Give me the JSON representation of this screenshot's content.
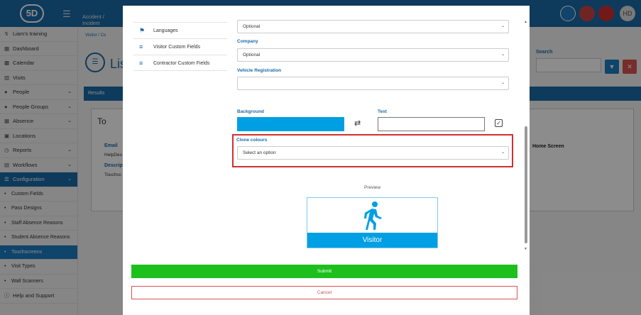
{
  "app": {
    "logo_text": "5D",
    "topbar_item": "Accident / Incident",
    "avatar_initials": "HD"
  },
  "sidebar": {
    "items": [
      {
        "label": "Liam's training",
        "icon": "training-icon"
      },
      {
        "label": "Dashboard",
        "icon": "dashboard-icon"
      },
      {
        "label": "Calendar",
        "icon": "calendar-icon"
      },
      {
        "label": "Visits",
        "icon": "visits-icon"
      },
      {
        "label": "People",
        "icon": "people-icon"
      },
      {
        "label": "People Groups",
        "icon": "people-groups-icon"
      },
      {
        "label": "Absence",
        "icon": "absence-icon"
      },
      {
        "label": "Locations",
        "icon": "locations-icon"
      },
      {
        "label": "Reports",
        "icon": "reports-icon"
      },
      {
        "label": "Workflows",
        "icon": "workflows-icon"
      },
      {
        "label": "Configuration",
        "icon": "configuration-icon"
      },
      {
        "label": "Custom Fields"
      },
      {
        "label": "Pass Designs"
      },
      {
        "label": "Staff Absence Reasons"
      },
      {
        "label": "Student Absence Reasons"
      },
      {
        "label": "Touchscreens"
      },
      {
        "label": "Visit Types"
      },
      {
        "label": "Wall Scanners"
      },
      {
        "label": "Help and Support",
        "icon": "help-icon"
      }
    ]
  },
  "background": {
    "breadcrumb": "Visitor / Co",
    "title": "Lis",
    "results_label": "Results",
    "search_label": "Search",
    "card_title": "To",
    "card_email_label": "Email",
    "card_email_value": "HelpDes",
    "card_desc_label": "Descrip",
    "card_desc_value": "Touchsc",
    "home_screen_label": "Home Screen"
  },
  "modal": {
    "nav": [
      {
        "label": "Languages",
        "icon": "flag-icon"
      },
      {
        "label": "Visitor Custom Fields",
        "icon": "checklist-icon"
      },
      {
        "label": "Contractor Custom Fields",
        "icon": "checklist-icon"
      }
    ],
    "first_select_value": "Optional",
    "company_label": "Company",
    "company_value": "Optional",
    "vehicle_label": "Vehicle Registration",
    "vehicle_value": "",
    "background_label": "Background",
    "background_color": "#009fe3",
    "text_label": "Text",
    "clone_label": "Clone colours",
    "clone_placeholder": "Select an option",
    "preview_label": "Preview",
    "preview_text": "Visitor",
    "submit_label": "Submit",
    "cancel_label": "Cancel"
  }
}
